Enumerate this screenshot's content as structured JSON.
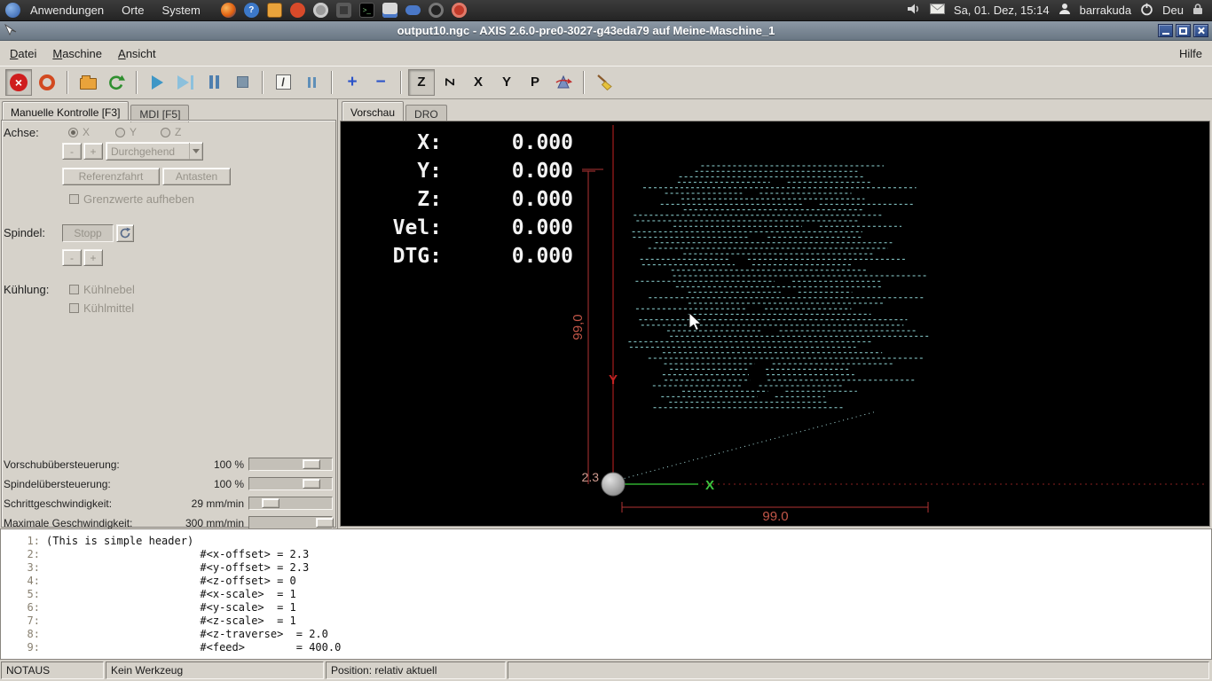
{
  "desktop_panel": {
    "menu_anwendungen": "Anwendungen",
    "menu_orte": "Orte",
    "menu_system": "System",
    "clock": "Sa, 01. Dez, 15:14",
    "user": "barrakuda",
    "keyboard_layout": "Deu"
  },
  "titlebar": {
    "title": "output10.ngc - AXIS 2.6.0-pre0-3027-g43eda79 auf Meine-Maschine_1"
  },
  "menubar": {
    "datei": "Datei",
    "maschine": "Maschine",
    "ansicht": "Ansicht",
    "hilfe": "Hilfe"
  },
  "icons": {
    "estop_glyph": "×",
    "skip_glyph": "/",
    "zoom_in_glyph": "+",
    "zoom_out_glyph": "−",
    "help_glyph": "?",
    "terminal_glyph": ">_"
  },
  "toolbar": {
    "views": {
      "top": "Z",
      "rotated": "Z",
      "side": "X",
      "front": "Y",
      "perspective": "P"
    }
  },
  "left_panel": {
    "tabs": [
      {
        "label": "Manuelle Kontrolle [F3]"
      },
      {
        "label": "MDI [F5]"
      }
    ],
    "axis_label": "Achse:",
    "axes": [
      {
        "label": "X"
      },
      {
        "label": "Y"
      },
      {
        "label": "Z"
      }
    ],
    "jog_minus": "-",
    "jog_plus": "+",
    "jog_increment": "Durchgehend",
    "home_button": "Referenzfahrt",
    "touch_off_button": "Antasten",
    "override_limits_label": "Grenzwerte aufheben",
    "spindle_label": "Spindel:",
    "spindle_stop_button": "Stopp",
    "spindle_minus": "-",
    "spindle_plus": "+",
    "coolant_label": "Kühlung:",
    "mist_label": "Kühlnebel",
    "flood_label": "Kühlmittel",
    "sliders": [
      {
        "label": "Vorschubübersteuerung:",
        "value": "100 %",
        "position_pct": 80
      },
      {
        "label": "Spindelübersteuerung:",
        "value": "100 %",
        "position_pct": 80
      },
      {
        "label": "Schrittgeschwindigkeit:",
        "value": "29 mm/min",
        "position_pct": 18
      },
      {
        "label": "Maximale Geschwindigkeit:",
        "value": "300 mm/min",
        "position_pct": 100
      }
    ]
  },
  "preview": {
    "tabs": [
      {
        "label": "Vorschau"
      },
      {
        "label": "DRO"
      }
    ],
    "dro": [
      {
        "label": "X:",
        "value": "0.000"
      },
      {
        "label": "Y:",
        "value": "0.000"
      },
      {
        "label": "Z:",
        "value": "0.000"
      },
      {
        "label": "Vel:",
        "value": "0.000"
      },
      {
        "label": "DTG:",
        "value": "0.000"
      }
    ],
    "axis_labels": {
      "x": "X",
      "y": "Y"
    },
    "dimensions": {
      "width_label": "99.0",
      "height_label": "99,0",
      "origin_offset_label": "2.3"
    }
  },
  "gcode": {
    "lines": [
      {
        "n": "1:",
        "t": "(This is simple header)"
      },
      {
        "n": "2:",
        "t": "                        #<x-offset> = 2.3"
      },
      {
        "n": "3:",
        "t": "                        #<y-offset> = 2.3"
      },
      {
        "n": "4:",
        "t": "                        #<z-offset> = 0"
      },
      {
        "n": "5:",
        "t": "                        #<x-scale>  = 1"
      },
      {
        "n": "6:",
        "t": "                        #<y-scale>  = 1"
      },
      {
        "n": "7:",
        "t": "                        #<z-scale>  = 1"
      },
      {
        "n": "8:",
        "t": "                        #<z-traverse>  = 2.0"
      },
      {
        "n": "9:",
        "t": "                        #<feed>        = 400.0"
      }
    ]
  },
  "statusbar": {
    "machine_state": "NOTAUS",
    "tool": "Kein Werkzeug",
    "position": "Position: relativ aktuell"
  }
}
